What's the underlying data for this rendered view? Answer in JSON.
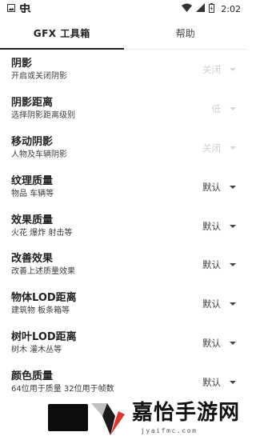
{
  "status_bar": {
    "time": "2:02"
  },
  "tabs": [
    {
      "label": "GFX 工具箱"
    },
    {
      "label": "帮助"
    }
  ],
  "settings": [
    {
      "title": "阴影",
      "subtitle": "开启或关闭阴影",
      "value": "关闭",
      "enabled": false
    },
    {
      "title": "阴影距离",
      "subtitle": "选择阴影距离级别",
      "value": "低",
      "enabled": false
    },
    {
      "title": "移动阴影",
      "subtitle": "人物及车辆阴影",
      "value": "关闭",
      "enabled": false
    },
    {
      "title": "纹理质量",
      "subtitle": "物品 车辆等",
      "value": "默认",
      "enabled": true
    },
    {
      "title": "效果质量",
      "subtitle": "火花 爆炸 射击等",
      "value": "默认",
      "enabled": true
    },
    {
      "title": "改善效果",
      "subtitle": "改善上述质量效果",
      "value": "默认",
      "enabled": true
    },
    {
      "title": "物体LOD距离",
      "subtitle": "建筑物 板条箱等",
      "value": "默认",
      "enabled": true
    },
    {
      "title": "树叶LOD距离",
      "subtitle": "树木 灌木丛等",
      "value": "默认",
      "enabled": true
    },
    {
      "title": "颜色质量",
      "subtitle": "64位用于质量 32位用于帧数",
      "value": "默认",
      "enabled": true
    }
  ],
  "watermark": {
    "brand": "嘉怡手游网",
    "url": "jyaifmc.com"
  }
}
